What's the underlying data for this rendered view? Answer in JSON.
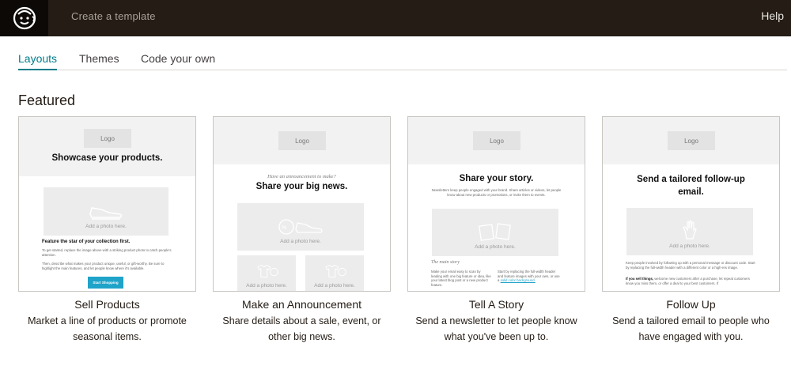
{
  "topbar": {
    "logo_icon": "mailchimp-freddie-icon",
    "title": "Create a template",
    "help_label": "Help"
  },
  "tabs": [
    {
      "label": "Layouts",
      "active": true
    },
    {
      "label": "Themes",
      "active": false
    },
    {
      "label": "Code your own",
      "active": false
    }
  ],
  "section_title": "Featured",
  "colors": {
    "topbar_bg": "#241c15",
    "accent": "#007c89",
    "preview_button": "#1fa3c9"
  },
  "cards": [
    {
      "title": "Sell Products",
      "description": "Market a line of products or promote seasonal items.",
      "preview": {
        "logo": "Logo",
        "headline": "Showcase your products.",
        "photo_label": "Add a photo here.",
        "photo_icon": "shoe-icon",
        "subhead": "Feature the star of your collection first.",
        "para1": "To get started, replace the image above with a striking product photo to catch people's attention.",
        "para2": "Then, describe what makes your product unique, useful, or gift-worthy. Be sure to highlight the main features, and let people know where it's available.",
        "button": "Start Shopping"
      }
    },
    {
      "title": "Make an Announcement",
      "description": "Share details about a sale, event, or other big news.",
      "preview": {
        "logo": "Logo",
        "kicker": "Have an announcement to make?",
        "headline": "Share your big news.",
        "photo_label": "Add a photo here.",
        "photo_icon": "shoe-sale-icon",
        "photo_label_2": "Add a photo here.",
        "photo_label_3": "Add a photo here."
      }
    },
    {
      "title": "Tell A Story",
      "description": "Send a newsletter to let people know what you've been up to.",
      "preview": {
        "logo": "Logo",
        "headline": "Share your story.",
        "intro": "Newsletters keep people engaged with your brand. Share articles or videos, let people know about new products or promotions, or invite them to events.",
        "photo_label": "Add a photo here.",
        "photo_icon": "photos-icon",
        "story_label": "The main story",
        "col1": "Make your email easy to scan by leading with one big feature or idea, like your latest blog post or a new product feature.",
        "col2": "Start by replacing the full-width header and feature images with your own, or use a",
        "col2_link": "solid color background."
      }
    },
    {
      "title": "Follow Up",
      "description": "Send a tailored email to people who have engaged with you.",
      "preview": {
        "logo": "Logo",
        "headline": "Send a tailored follow-up email.",
        "photo_label": "Add a photo here.",
        "photo_icon": "hand-icon",
        "para1": "Keep people involved by following up with a personal message or discount code. Start by replacing the full-width header with a different color or a high-res image.",
        "para2_bold": "If you sell things,",
        "para2": "welcome new customers after a purchase, let repeat customers know you miss them, or offer a deal to your best customers. If"
      }
    }
  ]
}
